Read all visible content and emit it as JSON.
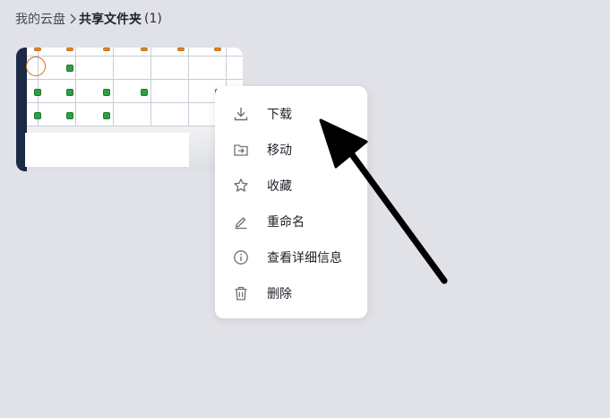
{
  "breadcrumb": {
    "root": "我的云盘",
    "current": "共享文件夹",
    "count": "(1)"
  },
  "file_card": {
    "more_icon": "more-horizontal-icon"
  },
  "context_menu": {
    "items": [
      {
        "label": "下载",
        "icon": "download-icon"
      },
      {
        "label": "移动",
        "icon": "move-folder-icon"
      },
      {
        "label": "收藏",
        "icon": "star-icon"
      },
      {
        "label": "重命名",
        "icon": "pencil-icon"
      },
      {
        "label": "查看详细信息",
        "icon": "info-icon"
      },
      {
        "label": "删除",
        "icon": "trash-icon"
      }
    ]
  },
  "colors": {
    "background": "#e1e2e8",
    "menu_background": "#ffffff",
    "text": "#1f2129",
    "icon": "#6b6f7a",
    "annotation_arrow": "#000000"
  }
}
